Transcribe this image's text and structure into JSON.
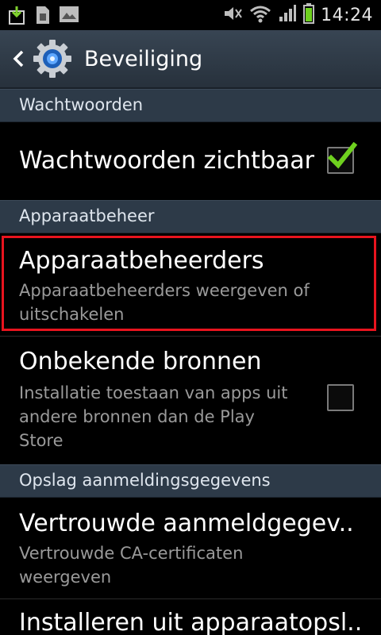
{
  "status_bar": {
    "time": "14:24",
    "icons_left": [
      "download-icon",
      "sim-card-icon",
      "image-icon"
    ],
    "icons_right": [
      "mute-icon",
      "wifi-icon",
      "signal-icon",
      "battery-icon"
    ]
  },
  "action_bar": {
    "title": "Beveiliging",
    "back_icon": "chevron-left-icon",
    "app_icon": "settings-gear-icon"
  },
  "sections": {
    "passwords": {
      "header": "Wachtwoorden",
      "visible_passwords": {
        "title": "Wachtwoorden zichtbaar",
        "checked": true
      }
    },
    "device_admin": {
      "header": "Apparaatbeheer",
      "admins": {
        "title": "Apparaatbeheerders",
        "subtitle_line1": "Apparaatbeheerders weergeven of",
        "subtitle_line2": "uitschakelen"
      },
      "unknown_sources": {
        "title": "Onbekende bronnen",
        "subtitle_line1": "Installatie toestaan van apps uit",
        "subtitle_line2": "andere bronnen dan de Play",
        "subtitle_line3": "Store",
        "checked": false
      }
    },
    "credential_storage": {
      "header": "Opslag aanmeldingsgegevens",
      "trusted": {
        "title": "Vertrouwde aanmeldgegev..",
        "subtitle_line1": "Vertrouwde CA-certificaten",
        "subtitle_line2": "weergeven"
      },
      "install": {
        "title": "Installeren uit apparaatopsl.."
      }
    }
  },
  "colors": {
    "highlight": "#e8141e",
    "check_green": "#6fd11f",
    "section_header_bg": "#2d3a48"
  }
}
